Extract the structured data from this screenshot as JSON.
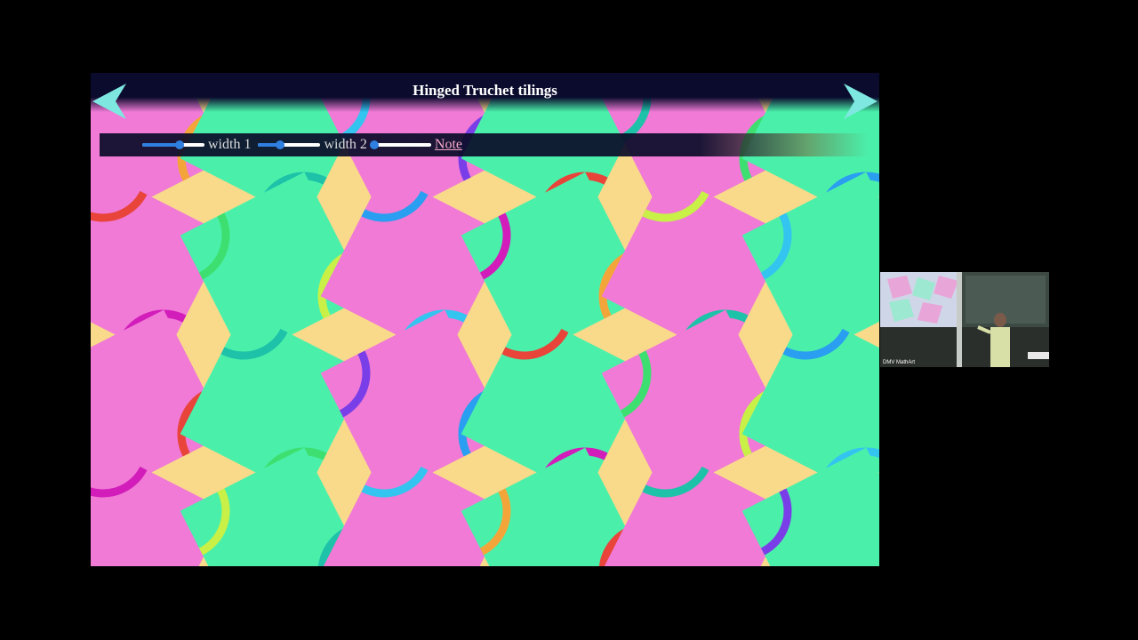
{
  "slide": {
    "title": "Hinged Truchet tilings",
    "controls": {
      "slider1_label": "width 1",
      "slider2_label": "width 2",
      "note_link": "Note",
      "slider0_value": 0.6,
      "slider1_value": 0.35,
      "slider2_value": 0.0
    },
    "colors": {
      "background": "#f9d98a",
      "square_pink": "#f07ad6",
      "square_green": "#4af0aa",
      "title_bar": "#0b0b2e",
      "arrow": "#7ee8e0"
    },
    "arc_colors": [
      "#d21dbb",
      "#c8f046",
      "#33c4f0",
      "#f4a53a",
      "#1ec2a8",
      "#7a3ee8",
      "#e8443a",
      "#3de070",
      "#2a9ef0"
    ]
  },
  "webcam": {
    "label": "DMV MathArt"
  }
}
